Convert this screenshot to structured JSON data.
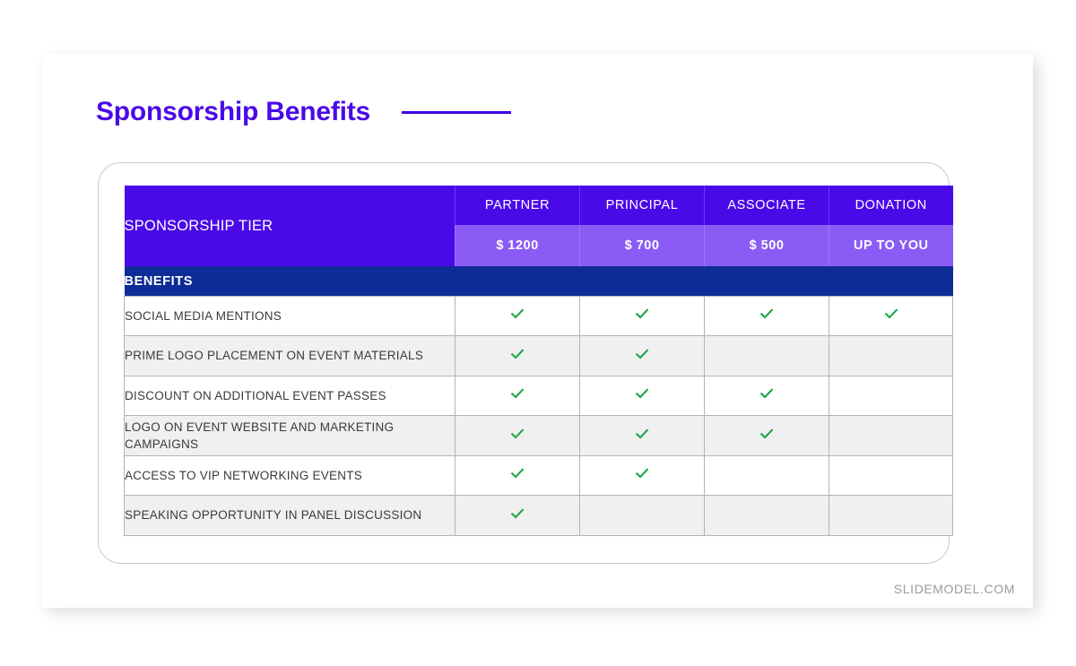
{
  "slide": {
    "title": "Sponsorship Benefits",
    "watermark": "SLIDEMODEL.COM"
  },
  "colors": {
    "title": "#4a0ae8",
    "header_purple": "#4a0ae8",
    "price_purple": "#8a5cf5",
    "benefits_navy": "#0d2c96",
    "check_green": "#1da84a",
    "row_gray": "#f0f0f0",
    "border_gray": "#b4b4b4",
    "frame_gray": "#c9c9c9"
  },
  "table": {
    "tier_label": "SPONSORSHIP TIER",
    "benefits_label": "BENEFITS",
    "tiers": [
      {
        "name": "PARTNER",
        "price": "$ 1200"
      },
      {
        "name": "PRINCIPAL",
        "price": "$ 700"
      },
      {
        "name": "ASSOCIATE",
        "price": "$ 500"
      },
      {
        "name": "DONATION",
        "price": "UP TO YOU"
      }
    ],
    "check_icon": "check-icon",
    "rows": [
      {
        "label": "SOCIAL MEDIA MENTIONS",
        "checks": [
          true,
          true,
          true,
          true
        ],
        "shade": "white",
        "lines": 1
      },
      {
        "label": "PRIME LOGO PLACEMENT ON EVENT MATERIALS",
        "checks": [
          true,
          true,
          false,
          false
        ],
        "shade": "gray",
        "lines": 2
      },
      {
        "label": "DISCOUNT ON ADDITIONAL EVENT PASSES",
        "checks": [
          true,
          true,
          true,
          false
        ],
        "shade": "white",
        "lines": 1
      },
      {
        "label": "LOGO ON EVENT WEBSITE AND MARKETING CAMPAIGNS",
        "checks": [
          true,
          true,
          true,
          false
        ],
        "shade": "gray",
        "lines": 2
      },
      {
        "label": "ACCESS TO VIP NETWORKING EVENTS",
        "checks": [
          true,
          true,
          false,
          false
        ],
        "shade": "white",
        "lines": 1
      },
      {
        "label": "SPEAKING OPPORTUNITY IN PANEL DISCUSSION",
        "checks": [
          true,
          false,
          false,
          false
        ],
        "shade": "gray",
        "lines": 2
      }
    ]
  }
}
